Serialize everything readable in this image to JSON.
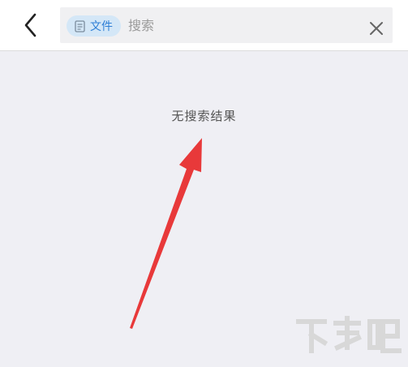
{
  "header": {
    "back_icon": "chevron-left-icon",
    "search": {
      "chip_icon": "document-icon",
      "chip_label": "文件",
      "placeholder": "搜索",
      "value": "",
      "clear_icon": "close-icon"
    }
  },
  "main": {
    "empty_message": "无搜索结果"
  },
  "overlay": {
    "arrow_color": "#e8393a"
  },
  "colors": {
    "background": "#efeff4",
    "chip_bg": "#d4e7f7",
    "chip_text": "#2f7fd6"
  }
}
